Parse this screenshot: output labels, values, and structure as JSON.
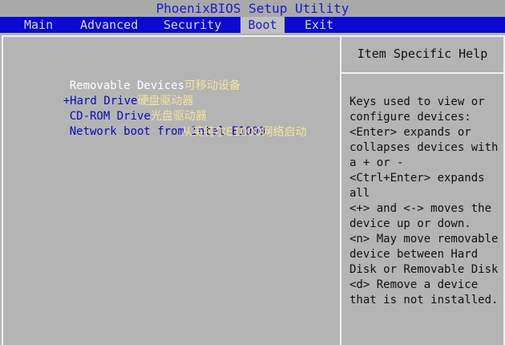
{
  "title": "PhoenixBIOS Setup Utility",
  "menu": {
    "main": "Main",
    "advanced": "Advanced",
    "security": "Security",
    "boot": "Boot",
    "exit": "Exit"
  },
  "boot": {
    "header": "Removable Devices",
    "header_cn": "可移动设备",
    "items": [
      {
        "label": "+Hard Drive",
        "cn": "硬盘驱动器"
      },
      {
        "label": "CD-ROM Drive",
        "cn": "光盘驱动器"
      },
      {
        "label": "Network boot from Intel E1000",
        "cn": "从英特尔E1000网络启动"
      }
    ]
  },
  "help": {
    "title": "Item Specific Help",
    "text": "Keys used to view or\nconfigure devices:\n<Enter> expands or\ncollapses devices with\na + or -\n<Ctrl+Enter> expands\nall\n<+> and <-> moves the\ndevice up or down.\n<n> May move removable\ndevice between Hard\nDisk or Removable Disk\n<d> Remove a device\nthat is not installed."
  },
  "colors": {
    "menu_bg": "#0a0ad0",
    "panel_bg": "#b4b4b4",
    "annotation": "#f3e49a"
  }
}
